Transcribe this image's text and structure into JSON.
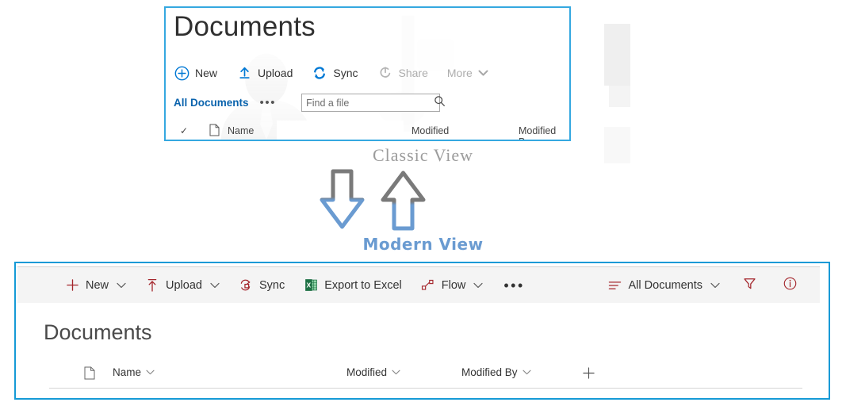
{
  "colors": {
    "panel_border_classic": "#35a8e0",
    "panel_border_modern": "#159ad6",
    "classic_accent": "#0a63ad",
    "classic_link": "#0a63ad",
    "classic_disabled": "#adadad",
    "modern_icon": "#a4262c",
    "modern_text": "#333333",
    "excel_green": "#1d7044",
    "arrow_gray": "#7a7a7a",
    "arrow_blue": "#6a9bd1",
    "classic_view_label": "#9c9c9c",
    "modern_view_label": "#6a9bd1",
    "toolbar_bg": "#f4f4f4"
  },
  "classic": {
    "title": "Documents",
    "toolbar": [
      {
        "label": "New",
        "icon": "plus-circle-icon",
        "disabled": false
      },
      {
        "label": "Upload",
        "icon": "upload-arrow-icon",
        "disabled": false
      },
      {
        "label": "Sync",
        "icon": "sync-icon",
        "disabled": false
      },
      {
        "label": "Share",
        "icon": "share-icon",
        "disabled": true
      },
      {
        "label": "More",
        "icon": "chevron-down-icon",
        "disabled": true
      }
    ],
    "view_link": "All Documents",
    "ellipsis": "•••",
    "search": {
      "value": "",
      "placeholder": "Find a file",
      "icon": "search-icon"
    },
    "header": {
      "check": "✓",
      "doc_icon": "document-icon",
      "name": "Name",
      "modified": "Modified",
      "modified_by": "Modified By"
    }
  },
  "annotation": {
    "classic_label": "Classic View",
    "modern_label": "Modern View",
    "down_arrow": "arrow-down-icon",
    "up_arrow": "arrow-up-icon"
  },
  "modern": {
    "toolbar": [
      {
        "label": "New",
        "icon": "plus-icon",
        "chevron": true
      },
      {
        "label": "Upload",
        "icon": "upload-arrow-icon",
        "chevron": true
      },
      {
        "label": "Sync",
        "icon": "sync-icon",
        "chevron": false
      },
      {
        "label": "Export to Excel",
        "icon": "excel-icon",
        "chevron": false
      },
      {
        "label": "Flow",
        "icon": "flow-icon",
        "chevron": true
      }
    ],
    "overflow": "•••",
    "view_selector": {
      "label": "All Documents",
      "icon": "list-view-icon",
      "chevron": true
    },
    "filter_icon": "filter-funnel-icon",
    "info_icon": "info-circle-icon",
    "title": "Documents",
    "header": {
      "doc_icon": "document-icon",
      "name": "Name",
      "modified": "Modified",
      "modified_by": "Modified By",
      "add_column": "+"
    }
  }
}
